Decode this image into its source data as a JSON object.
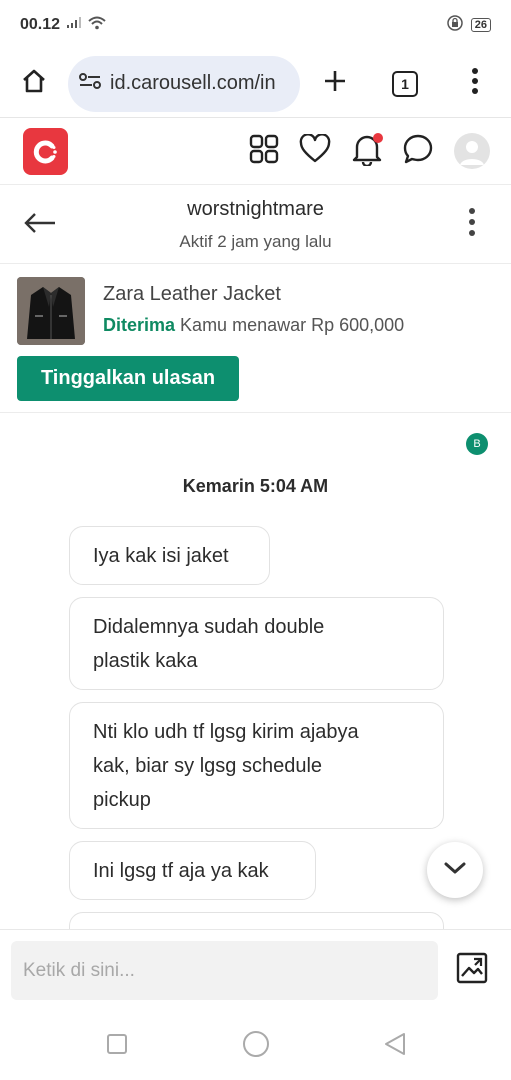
{
  "status_bar": {
    "time": "00.12",
    "battery": "26"
  },
  "browser": {
    "url": "id.carousell.com/in",
    "tab_count": "1"
  },
  "chat_header": {
    "username": "worstnightmare",
    "status": "Aktif 2 jam yang lalu"
  },
  "listing": {
    "title": "Zara Leather Jacket",
    "status_label": "Diterima",
    "offer_text": "Kamu menawar Rp 600,000",
    "review_button": "Tinggalkan ulasan"
  },
  "messages": {
    "read_badge": "B",
    "date_label": "Kemarin  5:04 AM",
    "items": [
      {
        "lines": [
          "Iya kak isi jaket"
        ]
      },
      {
        "lines": [
          "Didalemnya sudah double",
          "plastik kaka"
        ]
      },
      {
        "lines": [
          "Nti klo udh tf lgsg kirim ajabya",
          "kak, biar sy lgsg schedule",
          "pickup"
        ]
      },
      {
        "lines": [
          "Ini lgsg tf aja ya kak"
        ]
      }
    ]
  },
  "composer": {
    "placeholder": "Ketik di sini..."
  },
  "colors": {
    "brand_red": "#e8373f",
    "accent_green": "#0d8f6f"
  },
  "icons": {
    "home": "home-icon",
    "site_settings": "site-settings-icon",
    "new_tab": "plus-icon",
    "menu": "kebab-menu-icon",
    "categories": "grid-icon",
    "likes": "heart-icon",
    "notifications": "bell-icon",
    "inbox": "chat-bubble-icon",
    "back": "arrow-left-icon",
    "scroll_down": "chevron-down-icon",
    "image_upload": "image-icon"
  }
}
